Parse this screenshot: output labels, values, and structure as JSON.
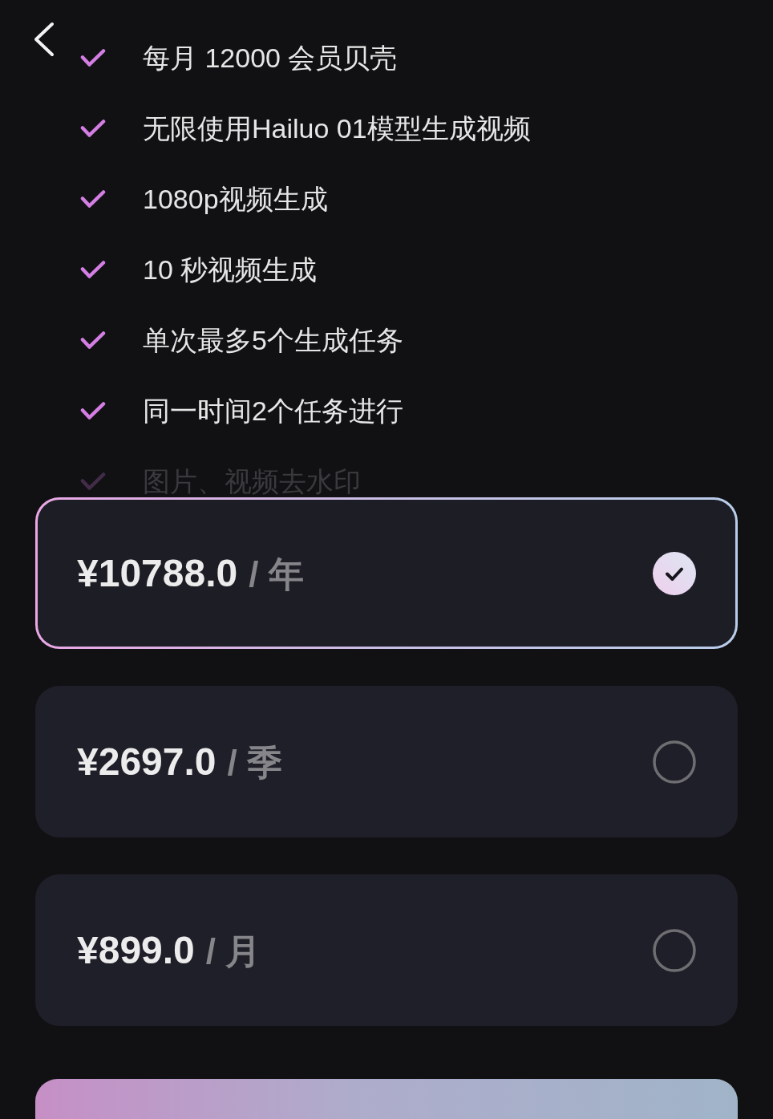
{
  "features": [
    "每月 12000 会员贝壳",
    "无限使用Hailuo 01模型生成视频",
    "1080p视频生成",
    "10 秒视频生成",
    "单次最多5个生成任务",
    "同一时间2个任务进行",
    "图片、视频去水印"
  ],
  "plans": [
    {
      "price": "¥10788.0",
      "period": "/ 年",
      "selected": true
    },
    {
      "price": "¥2697.0",
      "period": "/ 季",
      "selected": false
    },
    {
      "price": "¥899.0",
      "period": "/ 月",
      "selected": false
    }
  ]
}
